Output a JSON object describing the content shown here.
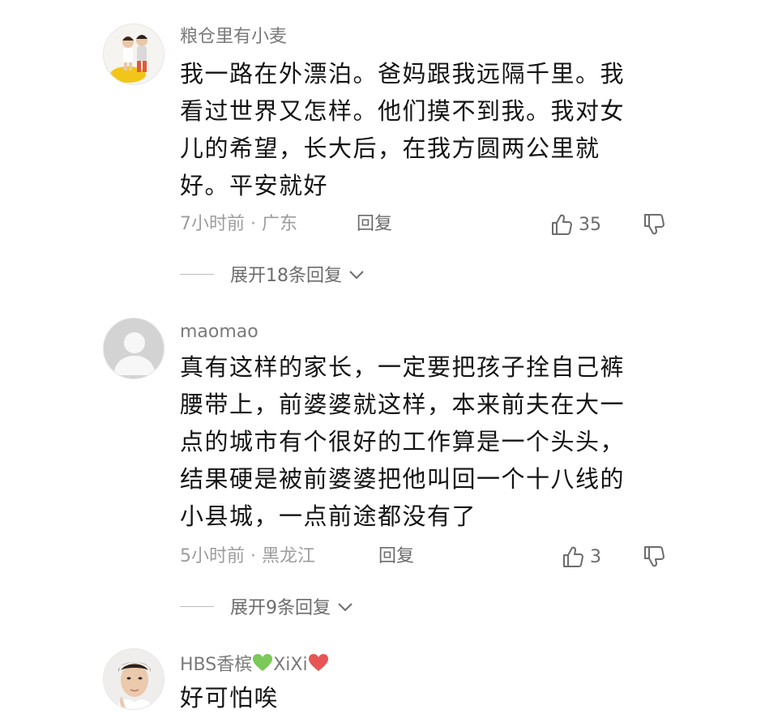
{
  "comments": [
    {
      "username": "粮仓里有小麦",
      "lines": [
        "我一路在外漂泊。爸妈跟我远隔千里。我",
        "看过世界又怎样。他们摸不到我。我对女",
        "儿的希望，长大后，在我方圆两公里就",
        "好。平安就好"
      ],
      "time_location": "7小时前 · 广东",
      "reply_label": "回复",
      "likes": "35",
      "expand_label": "展开18条回复"
    },
    {
      "username": "maomao",
      "lines": [
        "真有这样的家长，一定要把孩子拴自己裤",
        "腰带上，前婆婆就这样，本来前夫在大一",
        "点的城市有个很好的工作算是一个头头，",
        "结果硬是被前婆婆把他叫回一个十八线的",
        "小县城，一点前途都没有了"
      ],
      "time_location": "5小时前 · 黑龙江",
      "reply_label": "回复",
      "likes": "3",
      "expand_label": "展开9条回复"
    },
    {
      "username_prefix": "HBS香槟",
      "username_middle": "XiXi",
      "lines": [
        "好可怕唉"
      ]
    }
  ],
  "icons": {
    "like": "thumbs-up-icon",
    "dislike": "thumbs-down-icon",
    "expand": "chevron-down-icon",
    "green_heart": "green-heart-emoji",
    "red_heart": "red-heart-emoji"
  },
  "colors": {
    "green_heart": "#7cc85a",
    "red_heart": "#e85555"
  }
}
